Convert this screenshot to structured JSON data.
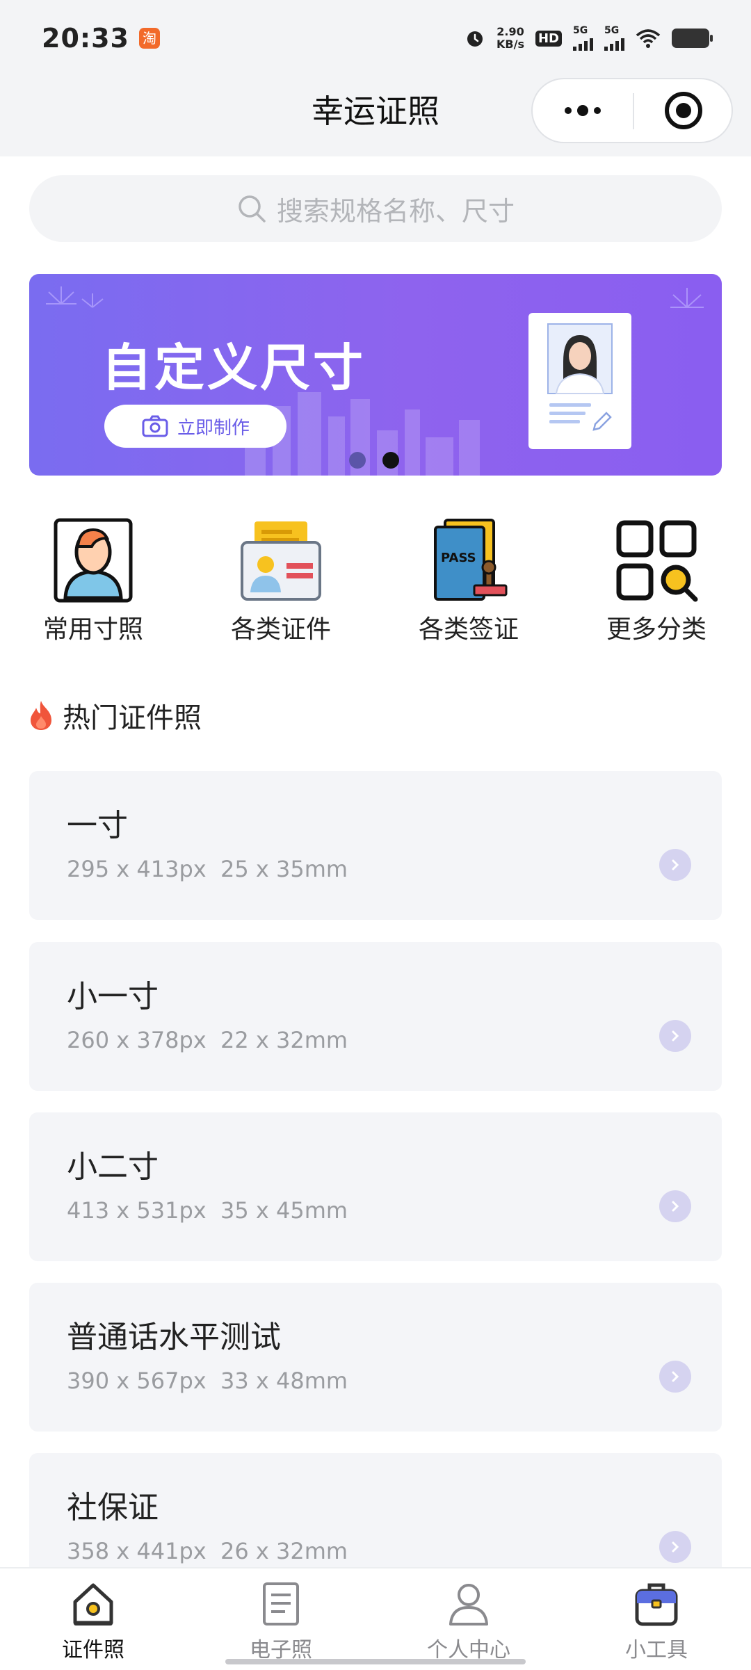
{
  "status_bar": {
    "time": "20:33",
    "app_badge": "淘",
    "net_speed_value": "2.90",
    "net_speed_unit": "KB/s",
    "hd_label": "HD",
    "sim1_label": "5G",
    "sim2_label": "5G"
  },
  "nav": {
    "title": "幸运证照"
  },
  "search": {
    "placeholder": "搜索规格名称、尺寸"
  },
  "banner": {
    "title": "自定义尺寸",
    "button_label": "立即制作",
    "active_slide": 2,
    "slide_count": 2
  },
  "categories": [
    {
      "label": "常用寸照",
      "icon": "person-portrait-icon"
    },
    {
      "label": "各类证件",
      "icon": "id-card-icon"
    },
    {
      "label": "各类签证",
      "icon": "passport-stamp-icon"
    },
    {
      "label": "更多分类",
      "icon": "grid-search-icon"
    }
  ],
  "hot_section": {
    "title": "热门证件照",
    "icon": "fire-icon",
    "items": [
      {
        "name": "一寸",
        "size": "295 x 413px  25 x 35mm"
      },
      {
        "name": "小一寸",
        "size": "260 x 378px  22 x 32mm"
      },
      {
        "name": "小二寸",
        "size": "413 x 531px  35 x 45mm"
      },
      {
        "name": "普通话水平测试",
        "size": "390 x 567px  33 x 48mm"
      },
      {
        "name": "社保证",
        "size": "358 x 441px  26 x 32mm"
      }
    ]
  },
  "tabbar": {
    "items": [
      {
        "label": "证件照",
        "icon": "home-icon",
        "active": true
      },
      {
        "label": "电子照",
        "icon": "document-icon",
        "active": false
      },
      {
        "label": "个人中心",
        "icon": "user-icon",
        "active": false
      },
      {
        "label": "小工具",
        "icon": "toolbox-icon",
        "active": false
      }
    ]
  },
  "colors": {
    "accent": "#7b6cf0",
    "active_tab": "#111111",
    "inactive_tab": "#8a8a8e",
    "card_bg": "#f4f5f8"
  }
}
